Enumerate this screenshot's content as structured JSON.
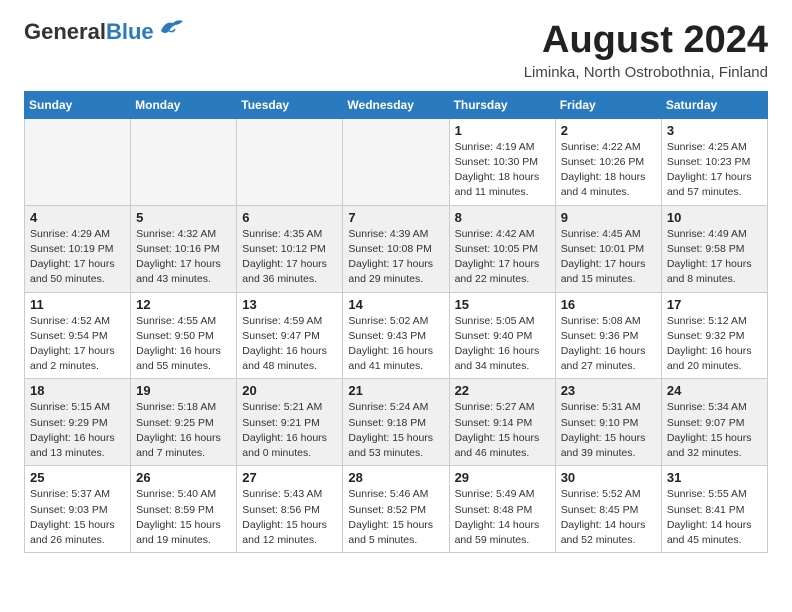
{
  "header": {
    "logo_general": "General",
    "logo_blue": "Blue",
    "month_title": "August 2024",
    "location": "Liminka, North Ostrobothnia, Finland"
  },
  "weekdays": [
    "Sunday",
    "Monday",
    "Tuesday",
    "Wednesday",
    "Thursday",
    "Friday",
    "Saturday"
  ],
  "weeks": [
    [
      {
        "day": "",
        "info": ""
      },
      {
        "day": "",
        "info": ""
      },
      {
        "day": "",
        "info": ""
      },
      {
        "day": "",
        "info": ""
      },
      {
        "day": "1",
        "info": "Sunrise: 4:19 AM\nSunset: 10:30 PM\nDaylight: 18 hours\nand 11 minutes."
      },
      {
        "day": "2",
        "info": "Sunrise: 4:22 AM\nSunset: 10:26 PM\nDaylight: 18 hours\nand 4 minutes."
      },
      {
        "day": "3",
        "info": "Sunrise: 4:25 AM\nSunset: 10:23 PM\nDaylight: 17 hours\nand 57 minutes."
      }
    ],
    [
      {
        "day": "4",
        "info": "Sunrise: 4:29 AM\nSunset: 10:19 PM\nDaylight: 17 hours\nand 50 minutes."
      },
      {
        "day": "5",
        "info": "Sunrise: 4:32 AM\nSunset: 10:16 PM\nDaylight: 17 hours\nand 43 minutes."
      },
      {
        "day": "6",
        "info": "Sunrise: 4:35 AM\nSunset: 10:12 PM\nDaylight: 17 hours\nand 36 minutes."
      },
      {
        "day": "7",
        "info": "Sunrise: 4:39 AM\nSunset: 10:08 PM\nDaylight: 17 hours\nand 29 minutes."
      },
      {
        "day": "8",
        "info": "Sunrise: 4:42 AM\nSunset: 10:05 PM\nDaylight: 17 hours\nand 22 minutes."
      },
      {
        "day": "9",
        "info": "Sunrise: 4:45 AM\nSunset: 10:01 PM\nDaylight: 17 hours\nand 15 minutes."
      },
      {
        "day": "10",
        "info": "Sunrise: 4:49 AM\nSunset: 9:58 PM\nDaylight: 17 hours\nand 8 minutes."
      }
    ],
    [
      {
        "day": "11",
        "info": "Sunrise: 4:52 AM\nSunset: 9:54 PM\nDaylight: 17 hours\nand 2 minutes."
      },
      {
        "day": "12",
        "info": "Sunrise: 4:55 AM\nSunset: 9:50 PM\nDaylight: 16 hours\nand 55 minutes."
      },
      {
        "day": "13",
        "info": "Sunrise: 4:59 AM\nSunset: 9:47 PM\nDaylight: 16 hours\nand 48 minutes."
      },
      {
        "day": "14",
        "info": "Sunrise: 5:02 AM\nSunset: 9:43 PM\nDaylight: 16 hours\nand 41 minutes."
      },
      {
        "day": "15",
        "info": "Sunrise: 5:05 AM\nSunset: 9:40 PM\nDaylight: 16 hours\nand 34 minutes."
      },
      {
        "day": "16",
        "info": "Sunrise: 5:08 AM\nSunset: 9:36 PM\nDaylight: 16 hours\nand 27 minutes."
      },
      {
        "day": "17",
        "info": "Sunrise: 5:12 AM\nSunset: 9:32 PM\nDaylight: 16 hours\nand 20 minutes."
      }
    ],
    [
      {
        "day": "18",
        "info": "Sunrise: 5:15 AM\nSunset: 9:29 PM\nDaylight: 16 hours\nand 13 minutes."
      },
      {
        "day": "19",
        "info": "Sunrise: 5:18 AM\nSunset: 9:25 PM\nDaylight: 16 hours\nand 7 minutes."
      },
      {
        "day": "20",
        "info": "Sunrise: 5:21 AM\nSunset: 9:21 PM\nDaylight: 16 hours\nand 0 minutes."
      },
      {
        "day": "21",
        "info": "Sunrise: 5:24 AM\nSunset: 9:18 PM\nDaylight: 15 hours\nand 53 minutes."
      },
      {
        "day": "22",
        "info": "Sunrise: 5:27 AM\nSunset: 9:14 PM\nDaylight: 15 hours\nand 46 minutes."
      },
      {
        "day": "23",
        "info": "Sunrise: 5:31 AM\nSunset: 9:10 PM\nDaylight: 15 hours\nand 39 minutes."
      },
      {
        "day": "24",
        "info": "Sunrise: 5:34 AM\nSunset: 9:07 PM\nDaylight: 15 hours\nand 32 minutes."
      }
    ],
    [
      {
        "day": "25",
        "info": "Sunrise: 5:37 AM\nSunset: 9:03 PM\nDaylight: 15 hours\nand 26 minutes."
      },
      {
        "day": "26",
        "info": "Sunrise: 5:40 AM\nSunset: 8:59 PM\nDaylight: 15 hours\nand 19 minutes."
      },
      {
        "day": "27",
        "info": "Sunrise: 5:43 AM\nSunset: 8:56 PM\nDaylight: 15 hours\nand 12 minutes."
      },
      {
        "day": "28",
        "info": "Sunrise: 5:46 AM\nSunset: 8:52 PM\nDaylight: 15 hours\nand 5 minutes."
      },
      {
        "day": "29",
        "info": "Sunrise: 5:49 AM\nSunset: 8:48 PM\nDaylight: 14 hours\nand 59 minutes."
      },
      {
        "day": "30",
        "info": "Sunrise: 5:52 AM\nSunset: 8:45 PM\nDaylight: 14 hours\nand 52 minutes."
      },
      {
        "day": "31",
        "info": "Sunrise: 5:55 AM\nSunset: 8:41 PM\nDaylight: 14 hours\nand 45 minutes."
      }
    ]
  ]
}
